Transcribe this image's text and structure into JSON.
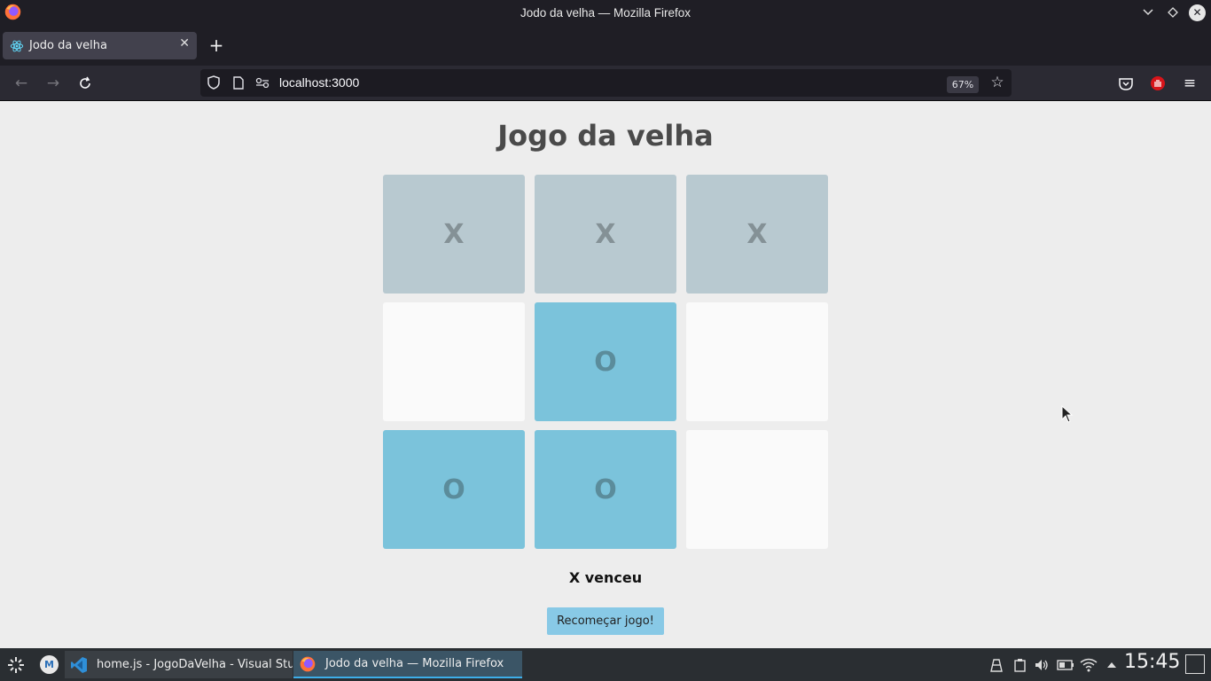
{
  "window": {
    "title": "Jodo da velha — Mozilla Firefox"
  },
  "tabs": [
    {
      "label": "Jodo da velha",
      "active": true
    }
  ],
  "navbar": {
    "url": "localhost:3000",
    "zoom": "67%"
  },
  "page": {
    "title": "Jogo da velha",
    "board": [
      [
        "X",
        "X",
        "X"
      ],
      [
        "",
        "O",
        ""
      ],
      [
        "O",
        "O",
        ""
      ]
    ],
    "winning_cells": [
      [
        0,
        0
      ],
      [
        0,
        1
      ],
      [
        0,
        2
      ]
    ],
    "status": "X venceu",
    "restart_label": "Recomeçar jogo!"
  },
  "colors": {
    "win_cell": "#b8c9d0",
    "o_cell": "#7bc3db",
    "empty_cell": "#fafafa",
    "button": "#88c9e6"
  },
  "taskbar": {
    "tasks": [
      {
        "label": "home.js - JogoDaVelha - Visual Stu...",
        "icon": "vscode-icon"
      },
      {
        "label": "Jodo da velha — Mozilla Firefox",
        "icon": "firefox-icon",
        "active": true
      }
    ],
    "clock": "15:45"
  }
}
